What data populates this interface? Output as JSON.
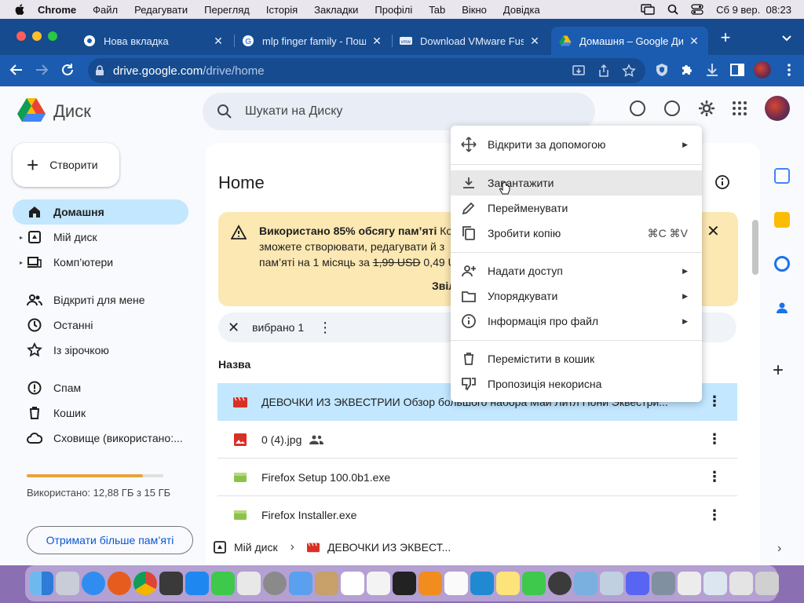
{
  "menubar": {
    "app": "Chrome",
    "items": [
      "Файл",
      "Редагувати",
      "Перегляд",
      "Історія",
      "Закладки",
      "Профілі",
      "Tab",
      "Вікно",
      "Довідка"
    ],
    "datetime": "Сб 9 вер.  08:23"
  },
  "tabs": [
    {
      "label": "Нова вкладка",
      "icon": "chrome-icon"
    },
    {
      "label": "mlp finger family - Пошук",
      "icon": "google-icon"
    },
    {
      "label": "Download VMware Fusion",
      "icon": "vmware-icon"
    },
    {
      "label": "Домашня – Google Диск",
      "icon": "drive-icon",
      "active": true
    }
  ],
  "address": {
    "domain": "drive.google.com",
    "path": "/drive/home"
  },
  "drive": {
    "title": "Диск",
    "search_placeholder": "Шукати на Диску",
    "create_label": "Створити",
    "nav": [
      {
        "label": "Домашня",
        "icon": "home-icon",
        "active": true
      },
      {
        "label": "Мій диск",
        "icon": "my-drive-icon",
        "expandable": true
      },
      {
        "label": "Комп’ютери",
        "icon": "computer-icon",
        "expandable": true
      },
      {
        "label": "Відкриті для мене",
        "icon": "shared-icon"
      },
      {
        "label": "Останні",
        "icon": "clock-icon"
      },
      {
        "label": "Із зірочкою",
        "icon": "star-icon"
      },
      {
        "label": "Спам",
        "icon": "spam-icon"
      },
      {
        "label": "Кошик",
        "icon": "trash-icon"
      },
      {
        "label": "Сховище (використано:...",
        "icon": "cloud-icon"
      }
    ],
    "storage": {
      "used_fraction": 0.85,
      "text": "Використано: 12,88 ГБ з 15 ГБ",
      "get_more": "Отримати більше пам’яті"
    },
    "page_title": "Home",
    "banner": {
      "bold": "Використано 85% обсягу пам’яті",
      "line1_rest": " Ко",
      "line2": "зможете створювати, редагувати й з",
      "line3_prefix": "пам’яті на 1 місяць за ",
      "old_price": "1,99 USD",
      "new_price": " 0,49 U",
      "link": "Звіл"
    },
    "selection": {
      "text": "вибрано 1"
    },
    "column_name": "Назва",
    "files": [
      {
        "name": "ДЕВОЧКИ ИЗ ЭКВЕСТРИИ Обзор большого набора Май Литл Пони Эквестри...",
        "type": "video",
        "color": "#d93025",
        "selected": true
      },
      {
        "name": "0 (4).jpg",
        "type": "image",
        "color": "#d93025",
        "shared": true
      },
      {
        "name": "Firefox Setup 100.0b1.exe",
        "type": "binary",
        "color": "#8bc34a"
      },
      {
        "name": "Firefox Installer.exe",
        "type": "binary",
        "color": "#8bc34a"
      }
    ],
    "breadcrumb": {
      "root": "Мій диск",
      "item": "ДЕВОЧКИ ИЗ ЭКВЕСТ..."
    }
  },
  "context_menu": [
    {
      "label": "Відкрити за допомогою",
      "icon": "open-with-icon",
      "submenu": true
    },
    {
      "label": "Завантажити",
      "icon": "download-icon",
      "hover": true
    },
    {
      "label": "Перейменувати",
      "icon": "rename-icon"
    },
    {
      "label": "Зробити копію",
      "icon": "copy-icon",
      "shortcut": "⌘C ⌘V"
    },
    {
      "label": "Надати доступ",
      "icon": "share-icon",
      "submenu": true
    },
    {
      "label": "Упорядкувати",
      "icon": "organize-icon",
      "submenu": true
    },
    {
      "label": "Інформація про файл",
      "icon": "info-icon",
      "submenu": true
    },
    {
      "label": "Перемістити в кошик",
      "icon": "trash-icon"
    },
    {
      "label": "Пропозиція некорисна",
      "icon": "thumbs-down-icon"
    }
  ],
  "colors": {
    "tabbar": "#164b8f",
    "toolbar": "#1b5cb0",
    "selected_row": "#c2e7ff",
    "banner": "#fce8b2",
    "accent": "#0b57d0"
  }
}
